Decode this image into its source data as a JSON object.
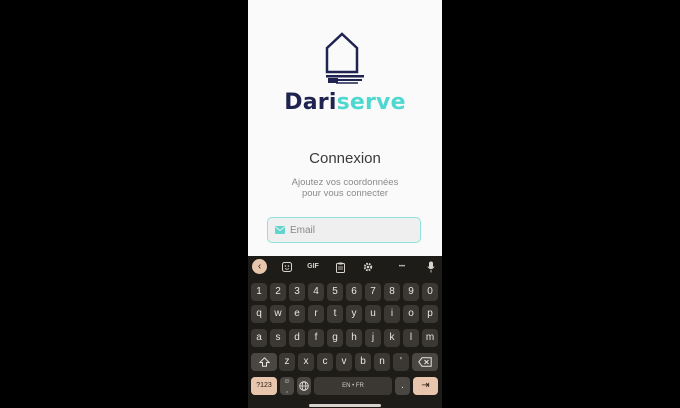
{
  "app": {
    "brand_part1": "Dari",
    "brand_part2": "serve",
    "title": "Connexion",
    "subtitle_line1": "Ajoutez vos coordonnées",
    "subtitle_line2": "pour vous connecter"
  },
  "email": {
    "placeholder": "Email",
    "icon": "mail-icon"
  },
  "colors": {
    "brand_dark": "#1f2350",
    "brand_accent": "#4fd8cf",
    "keyboard_bg": "#1e1c19",
    "key_accent": "#e7c6ad"
  },
  "keyboard": {
    "toolbar": {
      "back": "‹",
      "gif": "GIF",
      "more": "•••"
    },
    "numbers": [
      "1",
      "2",
      "3",
      "4",
      "5",
      "6",
      "7",
      "8",
      "9",
      "0"
    ],
    "row1": [
      "q",
      "w",
      "e",
      "r",
      "t",
      "y",
      "u",
      "i",
      "o",
      "p"
    ],
    "row2": [
      "a",
      "s",
      "d",
      "f",
      "g",
      "h",
      "j",
      "k",
      "l",
      "m"
    ],
    "row3": [
      "z",
      "x",
      "c",
      "v",
      "b",
      "n"
    ],
    "row3_extra": "'",
    "symbols_key": "?123",
    "emoji_key": "☺",
    "comma_key": ",",
    "language_key": "🌐",
    "space_label": "EN • FR",
    "period_key": ".",
    "enter_key": "⇥"
  }
}
